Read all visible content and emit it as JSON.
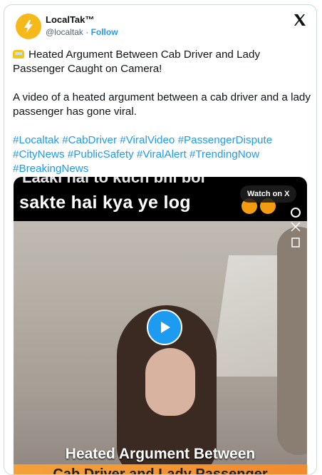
{
  "account": {
    "display_name": "LocalTak™",
    "handle": "@localtak",
    "separator": "·",
    "follow_label": "Follow"
  },
  "tweet": {
    "headline": "Heated Argument Between Cab Driver and Lady Passenger Caught on Camera!",
    "body": "A video of a heated argument between a cab driver and a lady passenger has gone viral.",
    "hashtags_line1": "#Localtak #CabDriver #ViralVideo #PassengerDispute",
    "hashtags_line2": "#CityNews #PublicSafety #ViralAlert #TrendingNow",
    "hashtags_line3": "#BreakingNews"
  },
  "video": {
    "top_caption_cut": "Laaki hai to kuch bhi bol",
    "top_caption": "sakte hai kya ye log",
    "watch_label": "Watch on X",
    "bottom_caption": "Heated Argument Between",
    "bottom_caption_cut": "Cab Driver and Lady Passenger"
  },
  "icons": {
    "avatar": "lightning-bolt-logo",
    "x_logo": "x-logo-icon",
    "play": "play-icon"
  },
  "colors": {
    "link": "#1d9bf0",
    "text": "#0f1419",
    "muted": "#536471",
    "avatar": "#f6b91a"
  }
}
